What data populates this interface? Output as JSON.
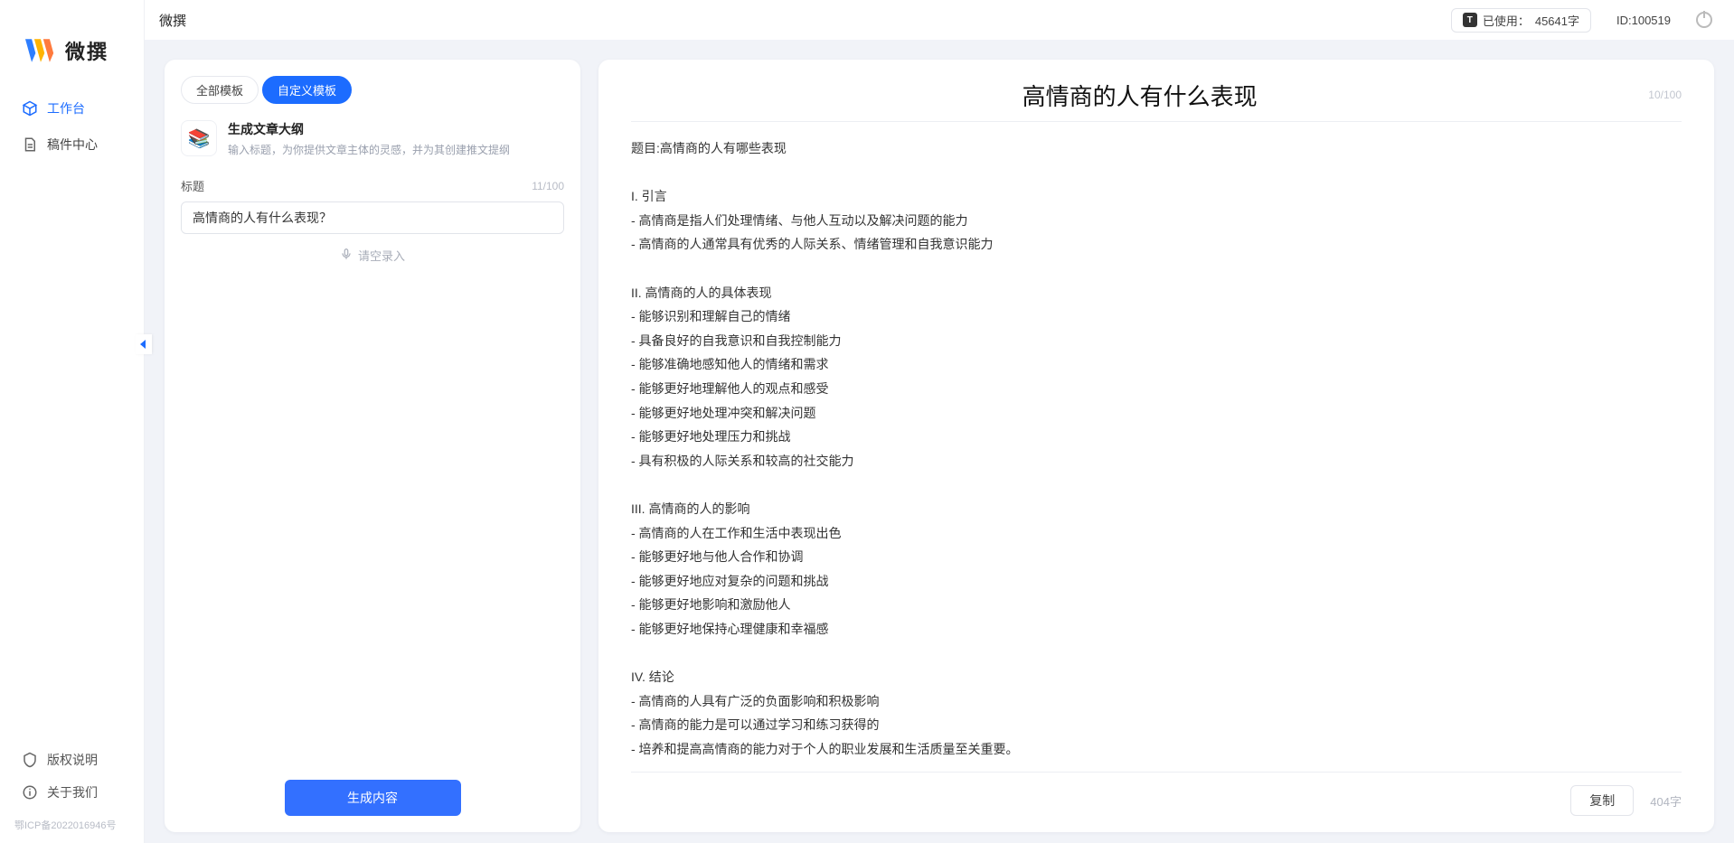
{
  "topbar": {
    "title": "微撰",
    "usage_label": "已使用：",
    "usage_value": "45641字",
    "usage_badge_char": "T",
    "id_label": "ID:100519"
  },
  "sidebar": {
    "brand": "微撰",
    "nav": [
      {
        "label": "工作台",
        "icon": "cube-icon",
        "active": true
      },
      {
        "label": "稿件中心",
        "icon": "doc-icon",
        "active": false
      }
    ],
    "bottom": [
      {
        "label": "版权说明",
        "icon": "shield-icon"
      },
      {
        "label": "关于我们",
        "icon": "info-icon"
      }
    ],
    "icp": "鄂ICP备2022016946号"
  },
  "left_panel": {
    "tabs": [
      {
        "label": "全部模板",
        "active": false
      },
      {
        "label": "自定义模板",
        "active": true
      }
    ],
    "template": {
      "title": "生成文章大纲",
      "desc": "输入标题，为你提供文章主体的灵感，并为其创建推文提纲"
    },
    "title_label": "标题",
    "title_count": "11/100",
    "title_value": "高情商的人有什么表现？",
    "voice_hint": "请空录入",
    "generate_label": "生成内容"
  },
  "right_panel": {
    "title_value": "高情商的人有什么表现",
    "title_placeholder": "",
    "title_count": "10/100",
    "body": "题目:高情商的人有哪些表现\n\nI. 引言\n- 高情商是指人们处理情绪、与他人互动以及解决问题的能力\n- 高情商的人通常具有优秀的人际关系、情绪管理和自我意识能力\n\nII. 高情商的人的具体表现\n- 能够识别和理解自己的情绪\n- 具备良好的自我意识和自我控制能力\n- 能够准确地感知他人的情绪和需求\n- 能够更好地理解他人的观点和感受\n- 能够更好地处理冲突和解决问题\n- 能够更好地处理压力和挑战\n- 具有积极的人际关系和较高的社交能力\n\nIII. 高情商的人的影响\n- 高情商的人在工作和生活中表现出色\n- 能够更好地与他人合作和协调\n- 能够更好地应对复杂的问题和挑战\n- 能够更好地影响和激励他人\n- 能够更好地保持心理健康和幸福感\n\nIV. 结论\n- 高情商的人具有广泛的负面影响和积极影响\n- 高情商的能力是可以通过学习和练习获得的\n- 培养和提高高情商的能力对于个人的职业发展和生活质量至关重要。",
    "copy_label": "复制",
    "word_count": "404字"
  }
}
